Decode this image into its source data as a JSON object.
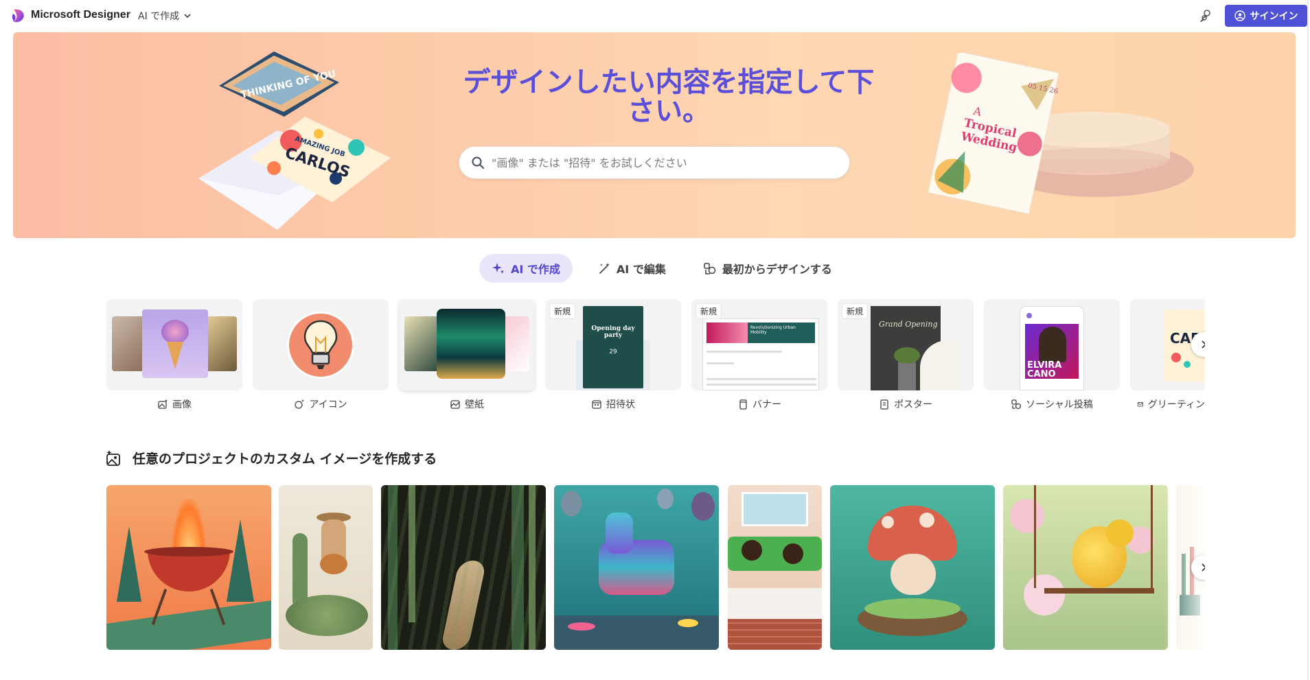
{
  "header": {
    "app_name": "Microsoft Designer",
    "mode_label": "AI で作成",
    "signin_label": "サインイン"
  },
  "hero": {
    "title": "デザインしたい内容を指定して下さい。",
    "search_placeholder": "\"画像\" または \"招待\" をお試しください",
    "card_texts": {
      "thinking": "THINKING OF YOU",
      "carlos_top": "AMAZING JOB",
      "carlos": "CARLOS",
      "wedding_line1": "A",
      "wedding_line2": "Tropical",
      "wedding_line3": "Wedding",
      "wedding_date": "05 15 26"
    }
  },
  "tabs": [
    {
      "label": "AI で作成",
      "icon": "sparkle-icon",
      "active": true
    },
    {
      "label": "AI で編集",
      "icon": "magic-wand-icon",
      "active": false
    },
    {
      "label": "最初からデザインする",
      "icon": "shapes-icon",
      "active": false
    }
  ],
  "categories": [
    {
      "label": "画像",
      "icon": "image-sparkle-icon",
      "badge": ""
    },
    {
      "label": "アイコン",
      "icon": "icon-sparkle-icon",
      "badge": ""
    },
    {
      "label": "壁紙",
      "icon": "wallpaper-icon",
      "badge": ""
    },
    {
      "label": "招待状",
      "icon": "calendar-icon",
      "badge": "新規",
      "thumb_text": "Opening day party",
      "thumb_date": "29"
    },
    {
      "label": "バナー",
      "icon": "banner-icon",
      "badge": "新規",
      "thumb_text": "Revolutionizing Urban Mobility"
    },
    {
      "label": "ポスター",
      "icon": "poster-icon",
      "badge": "新規",
      "thumb_text": "Grand Opening"
    },
    {
      "label": "ソーシャル投稿",
      "icon": "social-post-icon",
      "badge": "",
      "thumb_text": "ELVIRA CANO"
    },
    {
      "label": "グリーティン",
      "icon": "mail-icon",
      "badge": "",
      "thumb_text": "CAR"
    }
  ],
  "section": {
    "title": "任意のプロジェクトのカスタム イメージを作成する",
    "icon": "image-sparkle-icon"
  },
  "gallery": [
    {
      "name": "bbq-grill"
    },
    {
      "name": "cactus-guitarist"
    },
    {
      "name": "forest-path"
    },
    {
      "name": "pinata-party"
    },
    {
      "name": "kids-reading"
    },
    {
      "name": "mushroom-character"
    },
    {
      "name": "yellow-bird"
    },
    {
      "name": "art-supplies"
    }
  ],
  "colors": {
    "accent": "#4f52d6",
    "hero_title": "#5b4fd9",
    "tab_active_bg": "#ebe5fb"
  }
}
